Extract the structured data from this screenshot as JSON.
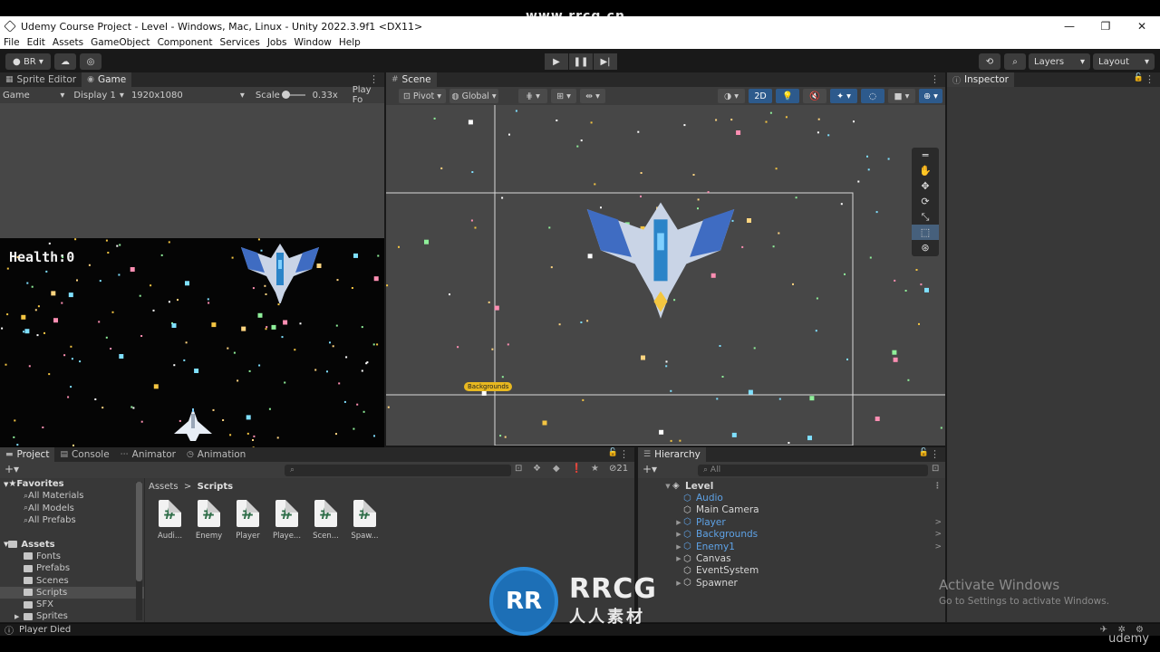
{
  "window": {
    "title": "Udemy Course Project - Level - Windows, Mac, Linux - Unity 2022.3.9f1 <DX11>",
    "minimize": "—",
    "restore": "❐",
    "close": "✕"
  },
  "watermark_top": "www.rrcg.cn",
  "menu": [
    "File",
    "Edit",
    "Assets",
    "GameObject",
    "Component",
    "Services",
    "Jobs",
    "Window",
    "Help"
  ],
  "toolbar": {
    "account": "BR",
    "play": "▶",
    "pause": "❚❚",
    "step": "▶|",
    "layers": "Layers",
    "layout": "Layout"
  },
  "game_panel": {
    "tabs": [
      "Sprite Editor",
      "Game"
    ],
    "mode": "Game",
    "display": "Display 1",
    "resolution": "1920x1080",
    "scale_label": "Scale",
    "scale_value": "0.33x",
    "play_focus": "Play Fo",
    "health_text": "Health:0"
  },
  "scene_panel": {
    "tab": "Scene",
    "pivot": "Pivot",
    "global": "Global",
    "mode_2d": "2D",
    "background_label": "Backgrounds"
  },
  "inspector": {
    "tab": "Inspector"
  },
  "project_panel": {
    "tabs": [
      "Project",
      "Console",
      "Animator",
      "Animation"
    ],
    "hidden_count": "21",
    "tree": [
      {
        "label": "Favorites",
        "type": "header",
        "indent": 0
      },
      {
        "label": "All Materials",
        "type": "search",
        "indent": 1
      },
      {
        "label": "All Models",
        "type": "search",
        "indent": 1
      },
      {
        "label": "All Prefabs",
        "type": "search",
        "indent": 1
      },
      {
        "label": "",
        "type": "spacer",
        "indent": 0
      },
      {
        "label": "Assets",
        "type": "header",
        "indent": 0
      },
      {
        "label": "Fonts",
        "type": "folder",
        "indent": 1
      },
      {
        "label": "Prefabs",
        "type": "folder",
        "indent": 1
      },
      {
        "label": "Scenes",
        "type": "folder",
        "indent": 1
      },
      {
        "label": "Scripts",
        "type": "folder",
        "indent": 1,
        "selected": true
      },
      {
        "label": "SFX",
        "type": "folder",
        "indent": 1
      },
      {
        "label": "Sprites",
        "type": "folder",
        "indent": 1
      }
    ],
    "breadcrumb_root": "Assets",
    "breadcrumb_current": "Scripts",
    "files": [
      "Audi...",
      "Enemy",
      "Player",
      "Playe...",
      "Scen...",
      "Spaw..."
    ]
  },
  "hierarchy": {
    "tab": "Hierarchy",
    "search_placeholder": "All",
    "items": [
      {
        "label": "Level",
        "root": true,
        "arrow": "▼",
        "prefab": false
      },
      {
        "label": "Audio",
        "prefab": true,
        "arrow": ""
      },
      {
        "label": "Main Camera",
        "prefab": false,
        "arrow": ""
      },
      {
        "label": "Player",
        "prefab": true,
        "arrow": "▶"
      },
      {
        "label": "Backgrounds",
        "prefab": true,
        "arrow": "▶"
      },
      {
        "label": "Enemy1",
        "prefab": true,
        "arrow": "▶"
      },
      {
        "label": "Canvas",
        "prefab": false,
        "arrow": "▶"
      },
      {
        "label": "EventSystem",
        "prefab": false,
        "arrow": ""
      },
      {
        "label": "Spawner",
        "prefab": false,
        "arrow": "▶"
      }
    ]
  },
  "status": {
    "message": "Player Died"
  },
  "overlay": {
    "activate_title": "Activate Windows",
    "activate_sub": "Go to Settings to activate Windows.",
    "logo_main": "RRCG",
    "logo_sub": "人人素材",
    "logo_mark": "RR",
    "udemy": "udemy"
  }
}
